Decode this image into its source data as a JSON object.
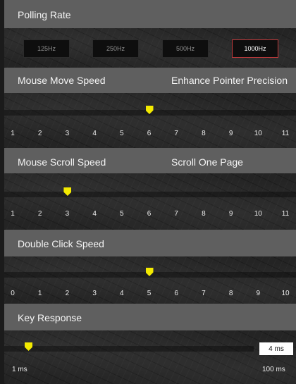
{
  "polling": {
    "header": "Polling Rate",
    "options": [
      "125Hz",
      "250Hz",
      "500Hz",
      "1000Hz"
    ],
    "selected": "1000Hz"
  },
  "move_speed": {
    "header": "Mouse Move Speed",
    "option": "Enhance Pointer Precision",
    "ticks": [
      "1",
      "2",
      "3",
      "4",
      "5",
      "6",
      "7",
      "8",
      "9",
      "10",
      "11"
    ],
    "value": 6
  },
  "scroll_speed": {
    "header": "Mouse Scroll Speed",
    "option": "Scroll One Page",
    "ticks": [
      "1",
      "2",
      "3",
      "4",
      "5",
      "6",
      "7",
      "8",
      "9",
      "10",
      "11"
    ],
    "value": 3
  },
  "double_click": {
    "header": "Double Click Speed",
    "ticks": [
      "0",
      "1",
      "2",
      "3",
      "4",
      "5",
      "6",
      "7",
      "8",
      "9",
      "10"
    ],
    "value": 5
  },
  "key_response": {
    "header": "Key Response",
    "value_text": "4 ms",
    "min_label": "1 ms",
    "max_label": "100 ms",
    "value": 4,
    "min": 1,
    "max": 100
  },
  "colors": {
    "accent_thumb": "#f3ea00",
    "selected_border": "#c0393b",
    "header_bg": "#5f5f5f"
  }
}
